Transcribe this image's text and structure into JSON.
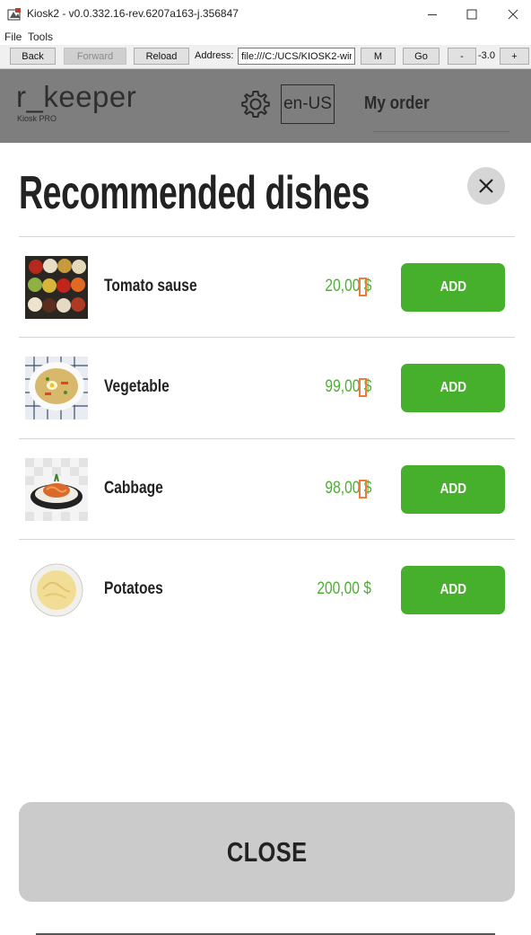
{
  "window": {
    "title": "Kiosk2 -  v0.0.332.16-rev.6207a163-j.356847",
    "menu": [
      "File",
      "Tools"
    ],
    "icons": [
      "app-icon",
      "minimize-icon",
      "maximize-icon",
      "close-window-icon"
    ]
  },
  "toolbar": {
    "back": "Back",
    "forward": "Forward",
    "reload": "Reload",
    "address_label": "Address:",
    "address_value": "file:///C:/UCS/KIOSK2-win",
    "m": "M",
    "go": "Go",
    "zoom_out": "-",
    "zoom_value": "-3.0",
    "zoom_in": "+"
  },
  "header": {
    "brand": "r_keeper",
    "brand_sub": "Kiosk PRO",
    "language": "en-US",
    "my_order": "My order",
    "icons": [
      "gear-icon"
    ]
  },
  "modal": {
    "title": "Recommended dishes",
    "close_label": "CLOSE",
    "items": [
      {
        "name": "Tomato sause",
        "price": "20,00 $",
        "action": "ADD",
        "image": "sauces-image"
      },
      {
        "name": "Vegetable",
        "price": "99,00 $",
        "action": "ADD",
        "image": "soup-image"
      },
      {
        "name": "Cabbage",
        "price": "98,00 $",
        "action": "ADD",
        "image": "pasta-image"
      },
      {
        "name": "Potatoes",
        "price": "200,00 $",
        "action": "ADD",
        "image": "mashed-potatoes-image"
      }
    ]
  },
  "colors": {
    "accent_green": "#46b02c",
    "price_green": "#4caf33",
    "overlay_gray": "#7e7e7e",
    "close_gray": "#cbcbcb"
  }
}
